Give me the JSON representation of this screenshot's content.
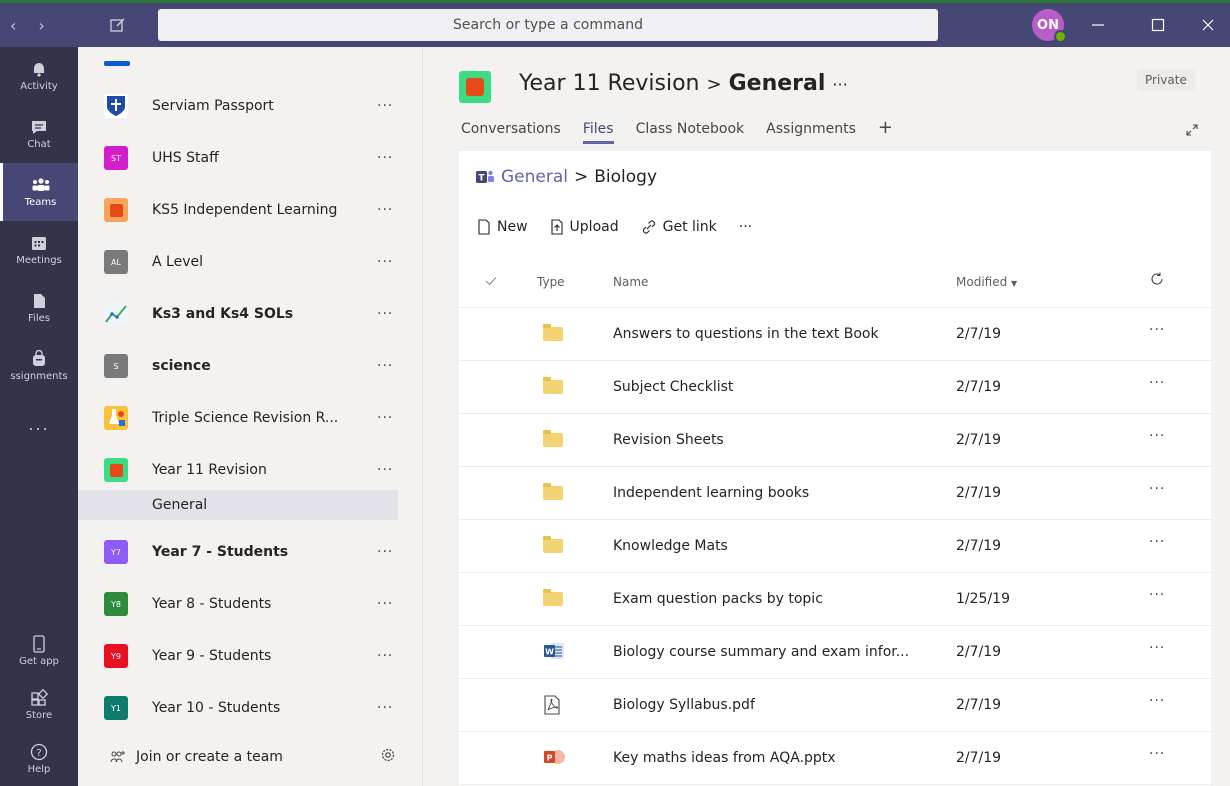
{
  "search": {
    "placeholder": "Search or type a command"
  },
  "user": {
    "initials": "ON"
  },
  "rail": {
    "items": [
      {
        "label": "Activity"
      },
      {
        "label": "Chat"
      },
      {
        "label": "Teams"
      },
      {
        "label": "Meetings"
      },
      {
        "label": "Files"
      },
      {
        "label": "ssignments"
      },
      {
        "label": "..."
      }
    ],
    "bottom": [
      {
        "label": "Get app"
      },
      {
        "label": "Store"
      },
      {
        "label": "Help"
      }
    ]
  },
  "teams": [
    {
      "name": "Serviam Passport",
      "tile": "",
      "color": "#1e4aa8"
    },
    {
      "name": "UHS Staff",
      "tile": "ST",
      "color": "#d21fc9"
    },
    {
      "name": "KS5 Independent Learning",
      "tile": "",
      "color": "#f7a35c"
    },
    {
      "name": "A Level",
      "tile": "AL",
      "color": "#7a7a7a"
    },
    {
      "name": "Ks3 and Ks4 SOLs",
      "tile": "",
      "color": "#cfe8f2"
    },
    {
      "name": "science",
      "tile": "S",
      "color": "#7a7a7a"
    },
    {
      "name": "Triple Science Revision R...",
      "tile": "",
      "color": "#f9c23c"
    },
    {
      "name": "Year 11 Revision",
      "tile": "",
      "color": "#3ddc84"
    },
    {
      "name": "Year 7 - Students",
      "tile": "Y7",
      "color": "#8e5cf5"
    },
    {
      "name": "Year 8 - Students",
      "tile": "Y8",
      "color": "#2e8b3e"
    },
    {
      "name": "Year 9 - Students",
      "tile": "Y9",
      "color": "#e81123"
    },
    {
      "name": "Year 10 - Students",
      "tile": "Y1",
      "color": "#0f7b6c"
    }
  ],
  "channel": {
    "name": "General"
  },
  "footer": {
    "join_label": "Join or create a team"
  },
  "header": {
    "team": "Year 11 Revision",
    "separator": ">",
    "channel": "General",
    "more": "···",
    "privacy": "Private"
  },
  "tabs": [
    "Conversations",
    "Files",
    "Class Notebook",
    "Assignments",
    "+"
  ],
  "breadcrumb": {
    "root": "General",
    "separator": ">",
    "current": "Biology"
  },
  "toolbar": {
    "new": "New",
    "upload": "Upload",
    "get_link": "Get link",
    "more": "···"
  },
  "columns": {
    "type": "Type",
    "name": "Name",
    "modified": "Modified"
  },
  "files": [
    {
      "type": "folder",
      "name": "Answers to questions in the text Book",
      "modified": "2/7/19"
    },
    {
      "type": "folder",
      "name": "Subject Checklist",
      "modified": "2/7/19"
    },
    {
      "type": "folder",
      "name": "Revision Sheets",
      "modified": "2/7/19"
    },
    {
      "type": "folder",
      "name": "Independent learning books",
      "modified": "2/7/19"
    },
    {
      "type": "folder",
      "name": "Knowledge Mats",
      "modified": "2/7/19"
    },
    {
      "type": "folder",
      "name": "Exam question packs by topic",
      "modified": "1/25/19"
    },
    {
      "type": "word",
      "name": "Biology course summary and exam infor...",
      "modified": "2/7/19"
    },
    {
      "type": "pdf",
      "name": "Biology Syllabus.pdf",
      "modified": "2/7/19"
    },
    {
      "type": "pptx",
      "name": "Key maths ideas from AQA.pptx",
      "modified": "2/7/19"
    }
  ],
  "colors": {
    "accent": "#6264a7",
    "titlebar": "#464775",
    "rail": "#33344a"
  }
}
